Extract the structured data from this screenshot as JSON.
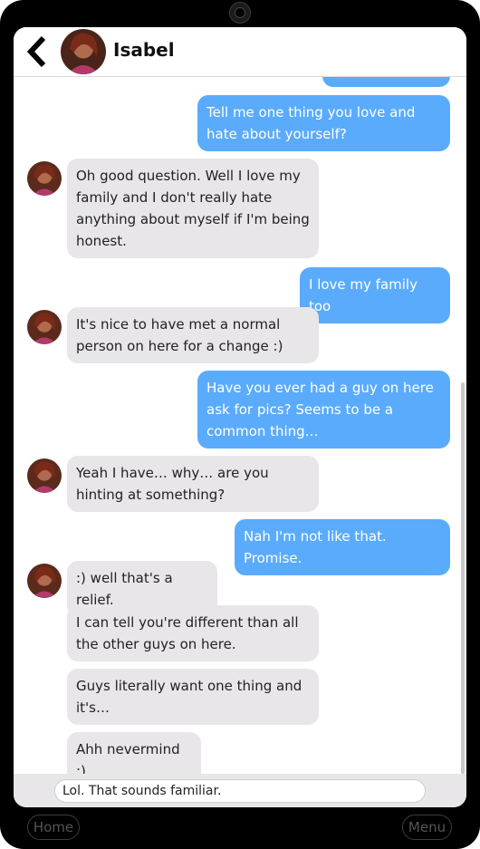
{
  "header": {
    "contact_name": "Isabel"
  },
  "messages": [
    {
      "from": "me",
      "text": "Tell me one thing you love and hate about yourself?"
    },
    {
      "from": "them",
      "text": "Oh good question. Well I love my family and I don't really hate anything about myself if I'm being honest."
    },
    {
      "from": "me",
      "text": "I love my family too"
    },
    {
      "from": "them",
      "text": "It's nice to have met a normal person on here for a change :)"
    },
    {
      "from": "me",
      "text": "Have you ever had a guy on here ask for pics? Seems to be a common thing…"
    },
    {
      "from": "them",
      "text": "Yeah I have… why… are you hinting at something?"
    },
    {
      "from": "me",
      "text": "Nah I'm not like that. Promise."
    },
    {
      "from": "them",
      "text": ":) well that's a relief."
    },
    {
      "from": "them",
      "text": "I can tell you're different than all the other guys on here."
    },
    {
      "from": "them",
      "text": "Guys literally want one thing and it's…"
    },
    {
      "from": "them",
      "text": "Ahh nevermind :)"
    }
  ],
  "input": {
    "value": "Lol. That sounds familiar."
  },
  "nav": {
    "home_label": "Home",
    "menu_label": "Menu"
  },
  "colors": {
    "sent_bubble": "#5aabfc",
    "received_bubble": "#e8e6e9",
    "frame": "#000000"
  },
  "icons": {
    "back": "chevron-left-icon",
    "avatar": "contact-avatar"
  }
}
